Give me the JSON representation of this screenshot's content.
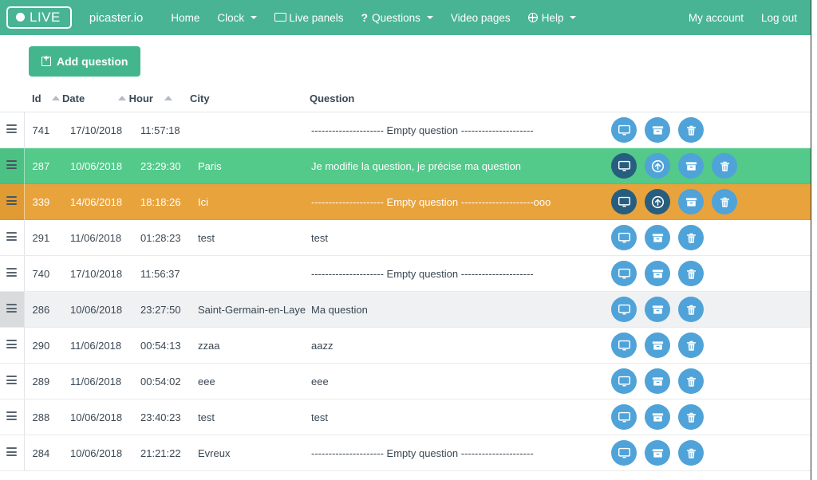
{
  "navbar": {
    "live_badge": "LIVE",
    "brand": "picaster.io",
    "links": [
      {
        "label": "Home",
        "icon": "",
        "caret": false
      },
      {
        "label": "Clock",
        "icon": "",
        "caret": true
      },
      {
        "label": "Live panels",
        "icon": "monitor-icon",
        "caret": false
      },
      {
        "label": "Questions",
        "icon": "question-mark-icon",
        "caret": true
      },
      {
        "label": "Video pages",
        "icon": "",
        "caret": false
      },
      {
        "label": "Help",
        "icon": "globe-icon",
        "caret": true
      }
    ],
    "right_links": [
      {
        "label": "My account"
      },
      {
        "label": "Log out"
      }
    ],
    "bg_color": "#48b493"
  },
  "toolbar": {
    "add_question_label": "Add question",
    "add_question_icon": "plus-square-icon",
    "add_button_color": "#44b68e"
  },
  "table": {
    "headers": [
      {
        "label": "",
        "sortable": false
      },
      {
        "label": "Id",
        "sortable": true
      },
      {
        "label": "Date",
        "sortable": true
      },
      {
        "label": "Hour",
        "sortable": true
      },
      {
        "label": "City",
        "sortable": false
      },
      {
        "label": "Question",
        "sortable": false
      },
      {
        "label": "",
        "sortable": false
      }
    ],
    "action_icons": {
      "display": "monitor-icon",
      "promote": "arrow-up-circle-icon",
      "archive": "archive-box-icon",
      "delete": "trash-icon"
    },
    "colors": {
      "selected_green": "#53c98a",
      "selected_orange": "#e8a33d",
      "button_blue": "#4fa3d8",
      "button_active_dark": "#275e7f",
      "stripe_gray": "#f0f1f2"
    },
    "rows": [
      {
        "id": "741",
        "date": "17/10/2018",
        "hour": "11:57:18",
        "city": "",
        "question": "--------------------- Empty question ---------------------",
        "state": "normal",
        "actions": [
          {
            "icon": "monitor-icon",
            "active": false
          },
          {
            "icon": "archive-box-icon",
            "active": false
          },
          {
            "icon": "trash-icon",
            "active": false
          }
        ]
      },
      {
        "id": "287",
        "date": "10/06/2018",
        "hour": "23:29:30",
        "city": "Paris",
        "question": "Je modifie la question, je précise ma question",
        "state": "selected-green",
        "actions": [
          {
            "icon": "monitor-icon",
            "active": true
          },
          {
            "icon": "arrow-up-circle-icon",
            "active": false
          },
          {
            "icon": "archive-box-icon",
            "active": false
          },
          {
            "icon": "trash-icon",
            "active": false
          }
        ]
      },
      {
        "id": "339",
        "date": "14/06/2018",
        "hour": "18:18:26",
        "city": "Ici",
        "question": "--------------------- Empty question ---------------------ooo",
        "state": "selected-orange",
        "actions": [
          {
            "icon": "monitor-icon",
            "active": true
          },
          {
            "icon": "arrow-up-circle-icon",
            "active": true
          },
          {
            "icon": "archive-box-icon",
            "active": false
          },
          {
            "icon": "trash-icon",
            "active": false
          }
        ]
      },
      {
        "id": "291",
        "date": "11/06/2018",
        "hour": "01:28:23",
        "city": "test",
        "question": "test",
        "state": "normal",
        "actions": [
          {
            "icon": "monitor-icon",
            "active": false
          },
          {
            "icon": "archive-box-icon",
            "active": false
          },
          {
            "icon": "trash-icon",
            "active": false
          }
        ]
      },
      {
        "id": "740",
        "date": "17/10/2018",
        "hour": "11:56:37",
        "city": "",
        "question": "--------------------- Empty question ---------------------",
        "state": "normal",
        "actions": [
          {
            "icon": "monitor-icon",
            "active": false
          },
          {
            "icon": "archive-box-icon",
            "active": false
          },
          {
            "icon": "trash-icon",
            "active": false
          }
        ]
      },
      {
        "id": "286",
        "date": "10/06/2018",
        "hour": "23:27:50",
        "city": "Saint-Germain-en-Laye",
        "question": "Ma question",
        "state": "striped",
        "actions": [
          {
            "icon": "monitor-icon",
            "active": false
          },
          {
            "icon": "archive-box-icon",
            "active": false
          },
          {
            "icon": "trash-icon",
            "active": false
          }
        ]
      },
      {
        "id": "290",
        "date": "11/06/2018",
        "hour": "00:54:13",
        "city": "zzaa",
        "question": "aazz",
        "state": "normal",
        "actions": [
          {
            "icon": "monitor-icon",
            "active": false
          },
          {
            "icon": "archive-box-icon",
            "active": false
          },
          {
            "icon": "trash-icon",
            "active": false
          }
        ]
      },
      {
        "id": "289",
        "date": "11/06/2018",
        "hour": "00:54:02",
        "city": "eee",
        "question": "eee",
        "state": "normal",
        "actions": [
          {
            "icon": "monitor-icon",
            "active": false
          },
          {
            "icon": "archive-box-icon",
            "active": false
          },
          {
            "icon": "trash-icon",
            "active": false
          }
        ]
      },
      {
        "id": "288",
        "date": "10/06/2018",
        "hour": "23:40:23",
        "city": "test",
        "question": "test",
        "state": "normal",
        "actions": [
          {
            "icon": "monitor-icon",
            "active": false
          },
          {
            "icon": "archive-box-icon",
            "active": false
          },
          {
            "icon": "trash-icon",
            "active": false
          }
        ]
      },
      {
        "id": "284",
        "date": "10/06/2018",
        "hour": "21:21:22",
        "city": "Evreux",
        "question": "--------------------- Empty question ---------------------",
        "state": "normal",
        "actions": [
          {
            "icon": "monitor-icon",
            "active": false
          },
          {
            "icon": "archive-box-icon",
            "active": false
          },
          {
            "icon": "trash-icon",
            "active": false
          }
        ]
      }
    ]
  }
}
